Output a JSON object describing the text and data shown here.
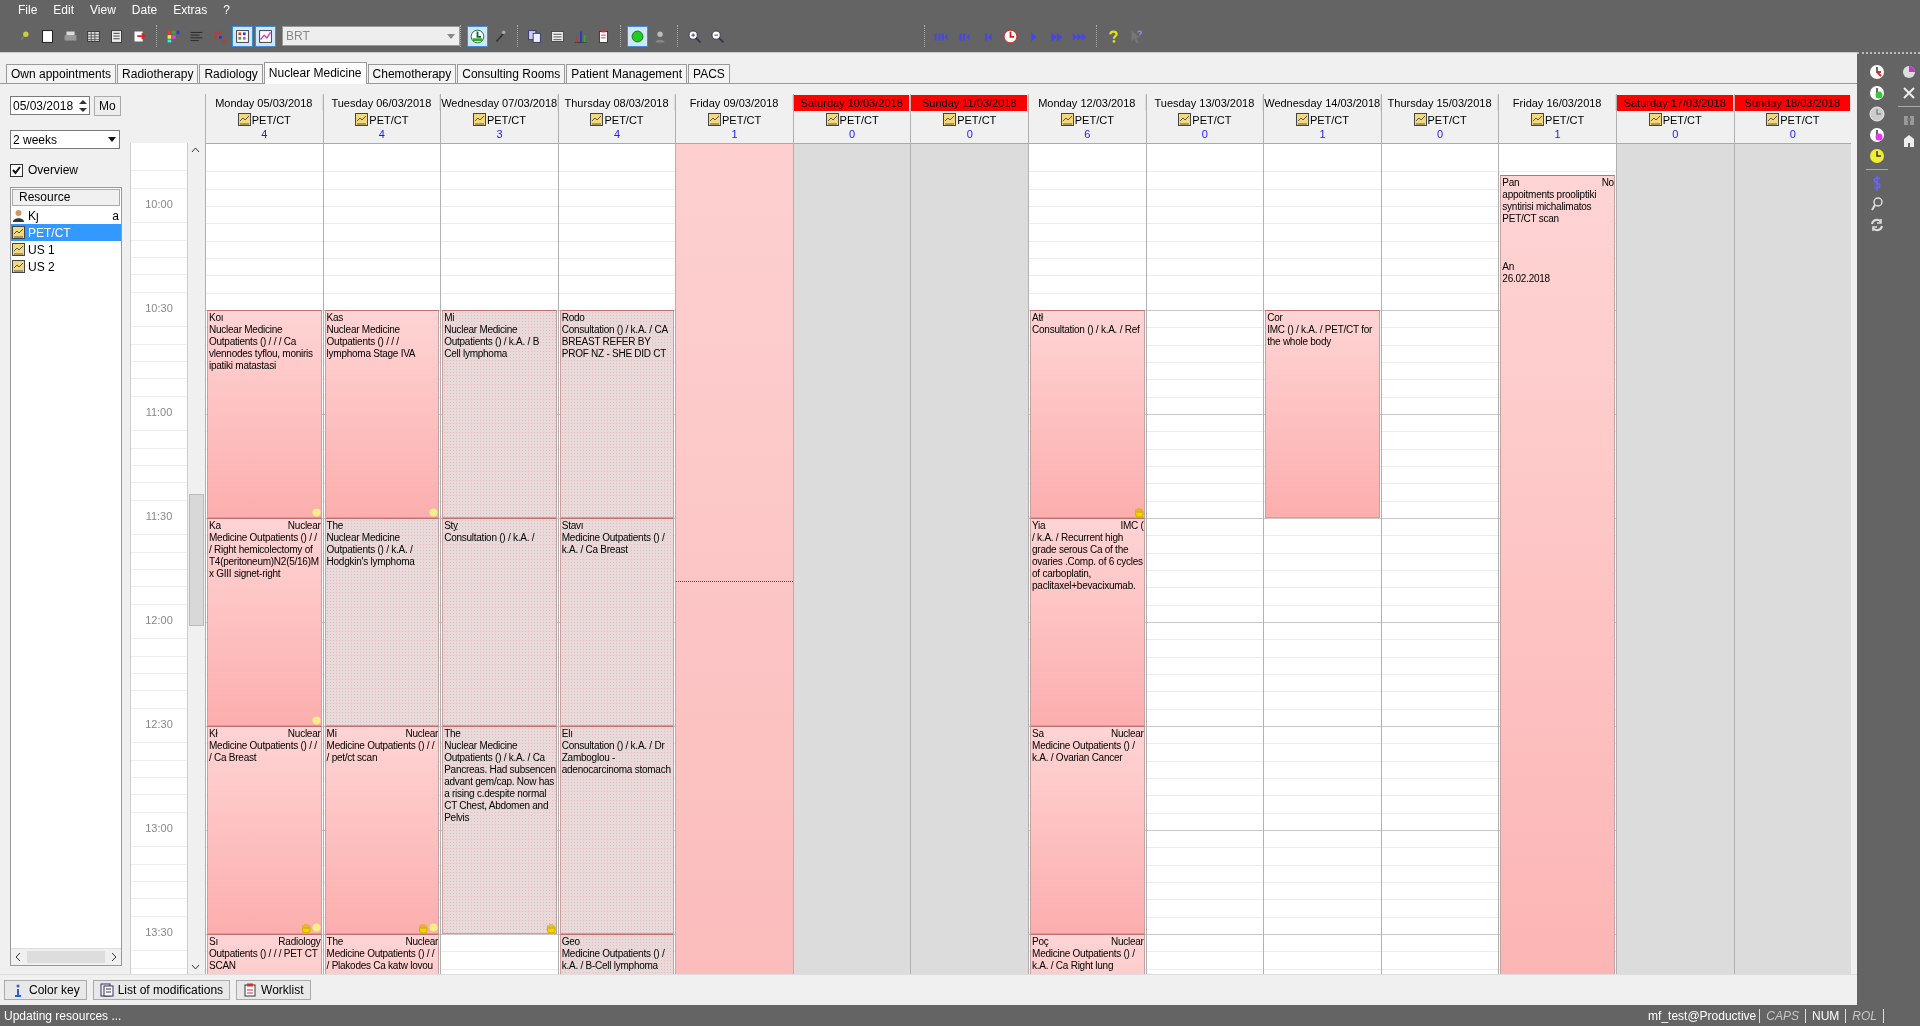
{
  "menu": [
    "File",
    "Edit",
    "View",
    "Date",
    "Extras",
    "?"
  ],
  "toolbar": {
    "combo": "BRT",
    "buttons": [
      {
        "pressed": false
      },
      {
        "pressed": false
      },
      {
        "pressed": false
      },
      {
        "pressed": false
      },
      {
        "pressed": false
      },
      {
        "pressed": false
      },
      {
        "pressed": false
      },
      {
        "pressed": false
      },
      {
        "pressed": false
      },
      {
        "pressed": true
      },
      {
        "pressed": true
      },
      {
        "pressed": true
      },
      {
        "pressed": false
      },
      {
        "pressed": false
      },
      {
        "pressed": false
      },
      {
        "pressed": false
      },
      {
        "pressed": false
      },
      {
        "pressed": true
      },
      {
        "pressed": false
      },
      {
        "pressed": false
      },
      {
        "pressed": false
      },
      {
        "pressed": false
      },
      {
        "pressed": false
      },
      {
        "pressed": false
      },
      {
        "pressed": false
      },
      {
        "pressed": false
      },
      {
        "pressed": false
      },
      {
        "pressed": false
      },
      {
        "pressed": false
      },
      {
        "pressed": false
      }
    ]
  },
  "tabs": [
    {
      "label": "Own appointments",
      "selected": false
    },
    {
      "label": "Radiotherapy",
      "selected": false
    },
    {
      "label": "Radiology",
      "selected": false
    },
    {
      "label": "Nuclear Medicine",
      "selected": true
    },
    {
      "label": "Chemotherapy",
      "selected": false
    },
    {
      "label": "Consulting Rooms",
      "selected": false
    },
    {
      "label": "Patient Management",
      "selected": false
    },
    {
      "label": "PACS",
      "selected": false
    }
  ],
  "date_field": {
    "value": "05/03/2018"
  },
  "weekday_button": "Mo",
  "range_select": {
    "value": "2 weeks"
  },
  "overview": {
    "label": "Overview",
    "checked": true
  },
  "resources": {
    "header": "Resource",
    "items": [
      {
        "label": "Kȷ",
        "suffix": "a",
        "kind": "person",
        "selected": false
      },
      {
        "label": "PET/CT",
        "kind": "device",
        "selected": true
      },
      {
        "label": "US 1",
        "kind": "device",
        "selected": false
      },
      {
        "label": "US 2",
        "kind": "device",
        "selected": false
      }
    ]
  },
  "times": [
    "10:00",
    "10:30",
    "11:00",
    "11:30",
    "12:00",
    "12:30",
    "13:00",
    "13:30"
  ],
  "days": [
    {
      "label": "Monday 05/03/2018",
      "resource": "PET/CT",
      "count": "4",
      "kind": "weekday",
      "today": false,
      "appointments": [
        {
          "kind": "booked",
          "name": "Koı",
          "text": "Nuclear Medicine Outpatients () /  /  / Ca vlennodes tyflou, moniris ipatiki matastasi",
          "hand": false,
          "dot": true
        },
        {
          "kind": "booked",
          "name": "Ka",
          "tag": "Nuclear",
          "text": "Medicine Outpatients () /  / / Right hemicolectomy of T4(peritoneum)N2(5/16)Mx GIII signet-right",
          "hand": false,
          "dot": true
        },
        {
          "kind": "booked",
          "name": "Kł",
          "tag": "Nuclear",
          "text": "Medicine Outpatients () /  / / Ca Breast",
          "hand": true,
          "dot": true
        },
        {
          "kind": "booked",
          "name": "Sı",
          "tag": "Radiology",
          "text": "Outpatients () /  /  / PET CT SCAN"
        }
      ]
    },
    {
      "label": "Tuesday 06/03/2018",
      "resource": "PET/CT",
      "count": "4",
      "kind": "weekday",
      "today": false,
      "appointments": [
        {
          "kind": "booked",
          "name": "Kas",
          "text": "Nuclear Medicine Outpatients () /  /  / lymphoma Stage IVA",
          "hand": false,
          "dot": true
        },
        {
          "kind": "pending",
          "name": "The",
          "text": "Nuclear Medicine Outpatients () / k.A. / Hodgkin's lymphoma",
          "hand": false,
          "dot": false
        },
        {
          "kind": "booked",
          "name": "Mi",
          "tag": "Nuclear",
          "text": "Medicine Outpatients () /  / / pet/ct scan",
          "hand": true,
          "dot": true
        },
        {
          "kind": "booked",
          "name": "The",
          "tag": "Nuclear",
          "text": "Medicine Outpatients () /  / / Plakodes Ca katw lovou"
        }
      ]
    },
    {
      "label": "Wednesday 07/03/2018",
      "resource": "PET/CT",
      "count": "3",
      "kind": "weekday",
      "today": false,
      "appointments": [
        {
          "kind": "pending",
          "name": "Mi",
          "text": "Nuclear Medicine Outpatients () / k.A. / B Cell lymphoma",
          "hand": false,
          "dot": false
        },
        {
          "kind": "pending",
          "name": "Stỵ",
          "text": "Consultation () / k.A. /",
          "hand": false,
          "dot": false
        },
        {
          "kind": "pending",
          "name": "The",
          "text": "Nuclear Medicine Outpatients () / k.A. / Ca Pancreas. Had  subsencen advant gem/cap. Now has a rising c.despite normal CT Chest, Abdomen and Pelvis",
          "hand": true,
          "dot": false
        }
      ]
    },
    {
      "label": "Thursday 08/03/2018",
      "resource": "PET/CT",
      "count": "4",
      "kind": "weekday",
      "today": false,
      "appointments": [
        {
          "kind": "pending",
          "name": "Rodo",
          "text": "Consultation () / k.A. / CA BREAST REFER BY PROF NZ - SHE DID CT",
          "hand": false,
          "dot": false
        },
        {
          "kind": "pending",
          "name": "Stavı",
          "text": "Medicine Outpatients () / k.A. / Ca Breast",
          "hand": false,
          "dot": false
        },
        {
          "kind": "pending",
          "name": "Elı",
          "text": "Consultation () / k.A. / Dr Zamboglou -adenocarcinoma stomach",
          "hand": false,
          "dot": false
        },
        {
          "kind": "pending",
          "name": "Geo",
          "text": "Medicine Outpatients () / k.A. / B-Cell lymphoma"
        }
      ]
    },
    {
      "label": "Friday 09/03/2018",
      "resource": "PET/CT",
      "count": "1",
      "kind": "blocked",
      "today": true
    },
    {
      "label": "Saturday 10/03/2018",
      "resource": "PET/CT",
      "count": "0",
      "kind": "weekend",
      "today": false
    },
    {
      "label": "Sunday 11/03/2018",
      "resource": "PET/CT",
      "count": "0",
      "kind": "weekend",
      "today": false
    },
    {
      "label": "Monday 12/03/2018",
      "resource": "PET/CT",
      "count": "6",
      "kind": "weekday",
      "today": false,
      "appointments": [
        {
          "kind": "booked",
          "name": "Atł",
          "text": "Consultation () / k.A. / Ref",
          "hand": true,
          "dot": false
        },
        {
          "kind": "booked",
          "name": "Yia",
          "tag": "IMC (",
          "text": "/ k.A. / Recurrent high grade serous Ca of the ovaries .Comp. of 6 cycles of carboplatin, paclitaxel+bevacixumab.",
          "hand": false,
          "dot": false
        },
        {
          "kind": "booked",
          "name": "Sa",
          "tag": "Nuclear",
          "text": "Medicine Outpatients () / k.A. / Ovarian Cancer",
          "hand": false,
          "dot": false
        },
        {
          "kind": "booked",
          "name": "Poç",
          "tag": "Nuclear",
          "text": "Medicine Outpatients () / k.A. / Ca Right lung"
        }
      ]
    },
    {
      "label": "Tuesday 13/03/2018",
      "resource": "PET/CT",
      "count": "0",
      "kind": "weekday",
      "today": false
    },
    {
      "label": "Wednesday 14/03/2018",
      "resource": "PET/CT",
      "count": "1",
      "kind": "weekday",
      "today": false,
      "appointments": [
        {
          "kind": "booked",
          "name": "Cor",
          "text": "IMC () / k.A. / PET/CT for the whole body",
          "hand": false,
          "dot": false
        }
      ]
    },
    {
      "label": "Thursday 15/03/2018",
      "resource": "PET/CT",
      "count": "0",
      "kind": "weekday",
      "today": false
    },
    {
      "label": "Friday 16/03/2018",
      "resource": "PET/CT",
      "count": "1",
      "kind": "weekday",
      "today": false,
      "appointments": [
        {
          "kind": "note",
          "name": "Pan",
          "tag": "No",
          "text": "appoitments prooliptiki syntirisi michalimatos PET/CT scan",
          "note_name": "An",
          "note": "26.02.2018"
        }
      ]
    },
    {
      "label": "Saturday 17/03/2018",
      "resource": "PET/CT",
      "count": "0",
      "kind": "weekend",
      "today": false
    },
    {
      "label": "Sunday 18/03/2018",
      "resource": "PET/CT",
      "count": "0",
      "kind": "weekend",
      "today": false
    }
  ],
  "bottom_buttons": [
    "Color key",
    "List of modifications",
    "Worklist"
  ],
  "status_bar": {
    "message": "Updating resources ...",
    "user": "mf_test@Productive",
    "indicators": [
      {
        "label": "CAPS",
        "on": false
      },
      {
        "label": "NUM",
        "on": true
      },
      {
        "label": "ROL",
        "on": false
      }
    ]
  }
}
